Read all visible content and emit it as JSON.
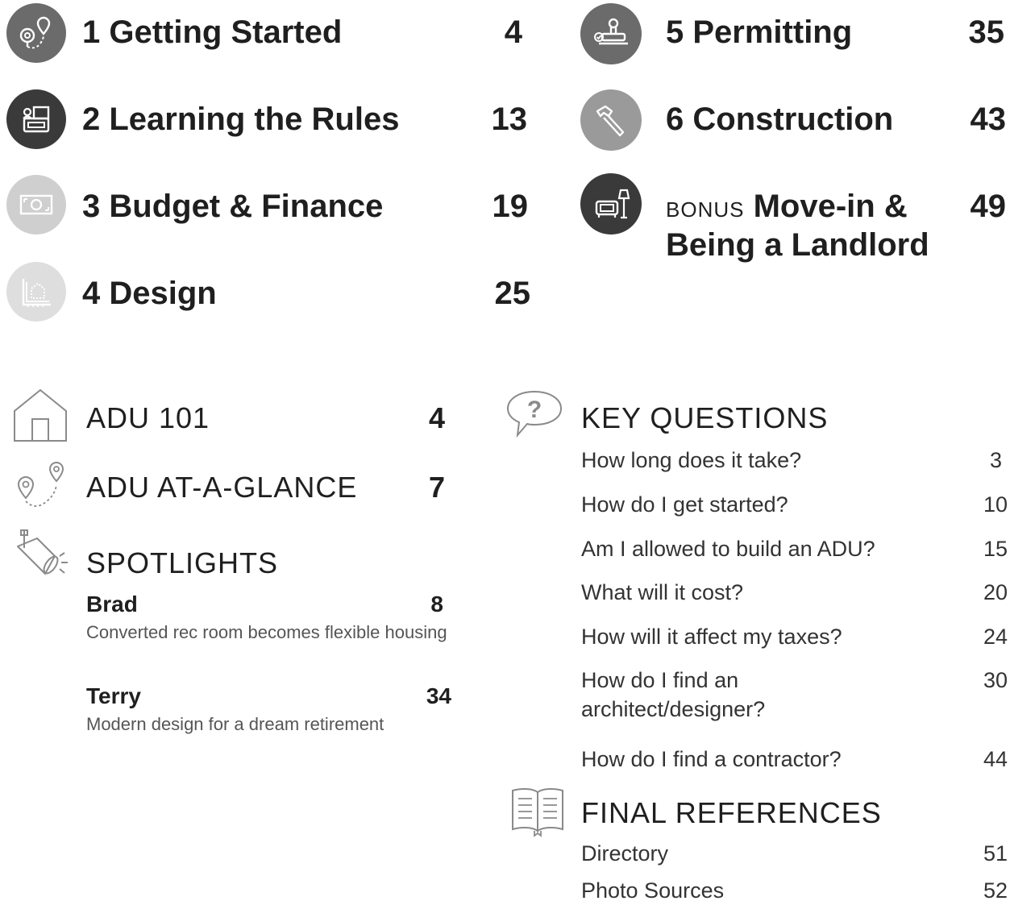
{
  "chapters": [
    {
      "number": "1",
      "title": "Getting Started",
      "page": "4",
      "icon": "map-pins-icon"
    },
    {
      "number": "2",
      "title": "Learning the Rules",
      "page": "13",
      "icon": "building-rules-icon"
    },
    {
      "number": "3",
      "title": "Budget & Finance",
      "page": "19",
      "icon": "money-icon"
    },
    {
      "number": "4",
      "title": "Design",
      "page": "25",
      "icon": "blueprint-icon"
    },
    {
      "number": "5",
      "title": "Permitting",
      "page": "35",
      "icon": "stamp-icon"
    },
    {
      "number": "6",
      "title": "Construction",
      "page": "43",
      "icon": "hammer-icon"
    }
  ],
  "bonus": {
    "prefix": "BONUS",
    "title_line1": "Move-in &",
    "title_line2": "Being a Landlord",
    "page": "49",
    "icon": "armchair-lamp-icon"
  },
  "sections": {
    "adu101": {
      "title": "ADU 101",
      "page": "4",
      "icon": "house-icon"
    },
    "glance": {
      "title": "ADU AT-A-GLANCE",
      "page": "7",
      "icon": "map-pins-icon"
    },
    "spotlights": {
      "title": "SPOTLIGHTS",
      "icon": "spotlight-icon",
      "items": [
        {
          "name": "Brad",
          "page": "8",
          "desc": "Converted rec room becomes flexible housing"
        },
        {
          "name": "Terry",
          "page": "34",
          "desc": "Modern design for a dream retirement"
        }
      ]
    }
  },
  "key_questions": {
    "title": "KEY QUESTIONS",
    "icon": "question-bubble-icon",
    "items": [
      {
        "q": "How long does it take?",
        "page": "3"
      },
      {
        "q": "How do I get started?",
        "page": "10"
      },
      {
        "q": "Am I allowed to build an ADU?",
        "page": "15"
      },
      {
        "q": "What will it cost?",
        "page": "20"
      },
      {
        "q": "How will it affect my taxes?",
        "page": "24"
      },
      {
        "q": "How do I find an architect/designer?",
        "page": "30"
      },
      {
        "q": "How do I find a contractor?",
        "page": "44"
      }
    ]
  },
  "final_references": {
    "title": "FINAL REFERENCES",
    "icon": "open-book-icon",
    "items": [
      {
        "label": "Directory",
        "page": "51"
      },
      {
        "label": "Photo Sources",
        "page": "52"
      }
    ]
  },
  "colors": {
    "dark_circle": "#3a3a3a",
    "mid_circle": "#6b6b6b",
    "light_circle": "#9a9a9a",
    "pale_circle": "#cfcfcf",
    "paler_circle": "#dedede"
  }
}
